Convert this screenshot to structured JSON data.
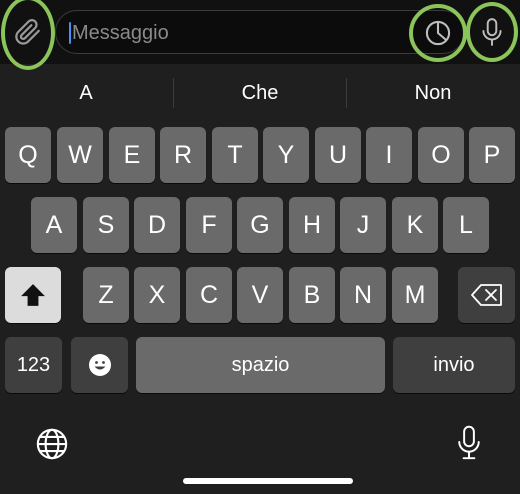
{
  "input_bar": {
    "placeholder": "Messaggio",
    "icons": [
      "paperclip-icon",
      "clock-icon",
      "microphone-icon"
    ],
    "highlight_color": "#8bc45a"
  },
  "suggestions": [
    "A",
    "Che",
    "Non"
  ],
  "keyboard": {
    "row1": [
      "Q",
      "W",
      "E",
      "R",
      "T",
      "Y",
      "U",
      "I",
      "O",
      "P"
    ],
    "row2": [
      "A",
      "S",
      "D",
      "F",
      "G",
      "H",
      "J",
      "K",
      "L"
    ],
    "row3": [
      "Z",
      "X",
      "C",
      "V",
      "B",
      "N",
      "M"
    ],
    "numbers_label": "123",
    "space_label": "spazio",
    "return_label": "invio",
    "icons": [
      "shift-icon",
      "backspace-icon",
      "emoji-icon",
      "globe-icon",
      "dictation-icon"
    ]
  }
}
